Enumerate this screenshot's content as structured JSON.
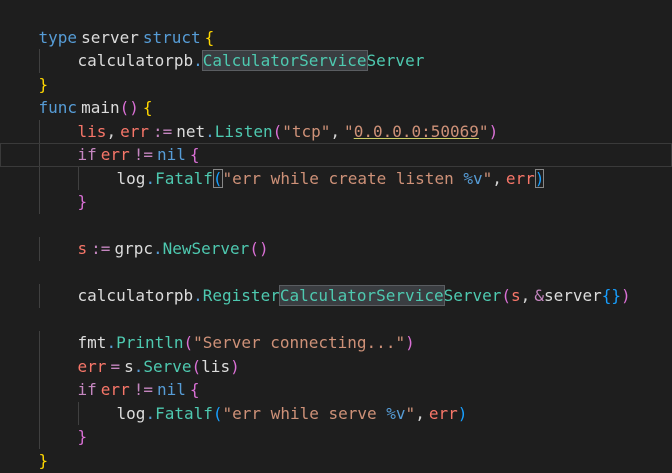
{
  "colors": {
    "background": "#1e1e1e",
    "keyword": "#569cd6",
    "control": "#c586c0",
    "identifier": "#dcdcdc",
    "variable": "#f77669",
    "function": "#4ec9b0",
    "string": "#ce9178",
    "bracket_gold": "#ffd700",
    "bracket_purple": "#da70d6",
    "bracket_blue": "#179fff",
    "dot": "#569cd6"
  },
  "code": {
    "l1": {
      "kw": "type",
      "name": "server",
      "kw2": "struct",
      "brace": "{"
    },
    "l2": {
      "pkg": "calculatorpb",
      "dot": ".",
      "type_a": "CalculatorService",
      "type_b": "Server"
    },
    "l3": {
      "brace": "}"
    },
    "l4": {
      "kw": "func",
      "name": "main",
      "parens": "()",
      "brace": "{"
    },
    "l5": {
      "v1": "lis",
      "comma": ",",
      "v2": "err",
      "op": ":=",
      "pkg": "net",
      "dot": ".",
      "fn": "Listen",
      "open": "(",
      "s1": "\"tcp\"",
      "comma2": ",",
      "q1": "\"",
      "s2": "0.0.0.0:50069",
      "q2": "\"",
      "close": ")"
    },
    "l6": {
      "kw": "if",
      "v": "err",
      "op": "!=",
      "nil": "nil",
      "brace": "{"
    },
    "l7": {
      "pkg": "log",
      "dot": ".",
      "fn": "Fatalf",
      "open": "(",
      "s": "\"err while create listen ",
      "fmt": "%v",
      "q": "\"",
      "comma": ",",
      "v": "err",
      "close": ")"
    },
    "l8": {
      "brace": "}"
    },
    "l10": {
      "v": "s",
      "op": ":=",
      "pkg": "grpc",
      "dot": ".",
      "fn": "NewServer",
      "parens": "()"
    },
    "l12": {
      "pkg": "calculatorpb",
      "dot": ".",
      "fn_a": "Register",
      "fn_b": "CalculatorService",
      "fn_c": "Server",
      "open": "(",
      "a1": "s",
      "comma": ",",
      "amp": "&",
      "a2": "server",
      "braces": "{}",
      "close": ")"
    },
    "l14": {
      "pkg": "fmt",
      "dot": ".",
      "fn": "Println",
      "open": "(",
      "s": "\"Server connecting...\"",
      "close": ")"
    },
    "l15": {
      "v": "err",
      "op": "=",
      "recv": "s",
      "dot": ".",
      "fn": "Serve",
      "open": "(",
      "arg": "lis",
      "close": ")"
    },
    "l16": {
      "kw": "if",
      "v": "err",
      "op": "!=",
      "nil": "nil",
      "brace": "{"
    },
    "l17": {
      "pkg": "log",
      "dot": ".",
      "fn": "Fatalf",
      "open": "(",
      "s": "\"err while serve ",
      "fmt": "%v",
      "q": "\"",
      "comma": ",",
      "v": "err",
      "close": ")"
    },
    "l18": {
      "brace": "}"
    },
    "l19": {
      "brace": "}"
    }
  }
}
